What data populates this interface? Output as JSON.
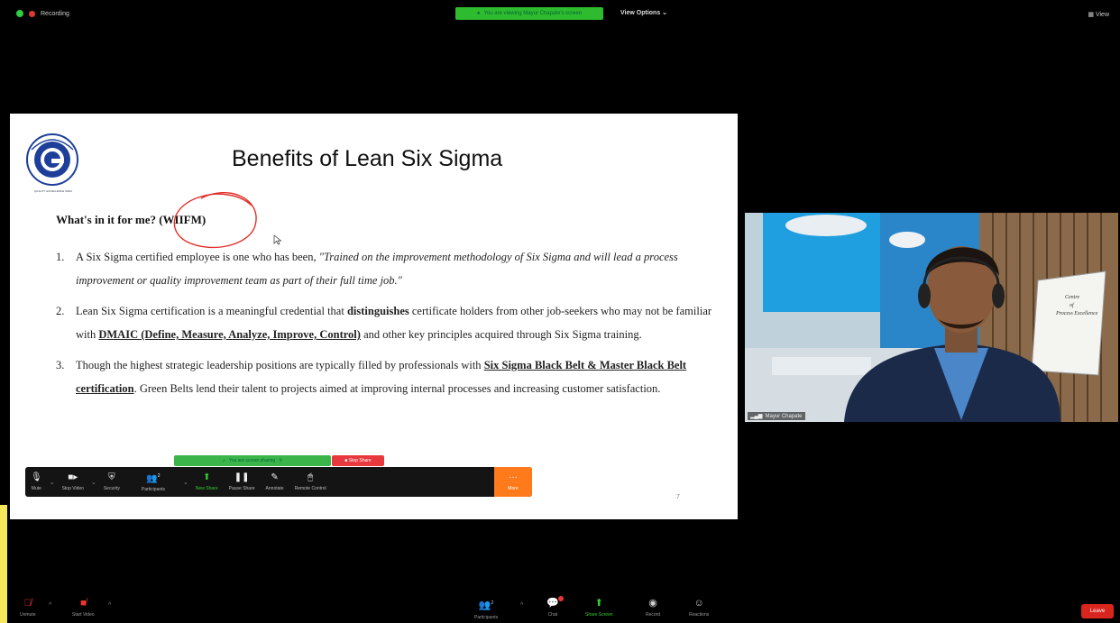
{
  "top_bar": {
    "recording_label": "Recording",
    "viewing_banner": "You are viewing Mayur Chapate's screen",
    "view_options": "View Options ⌄",
    "view_label": "View"
  },
  "slide": {
    "logo_caption": "QUALITY EXCELLENCE INDIA",
    "title": "Benefits of Lean Six Sigma",
    "subtitle": "What's in it for me? (WIIFM)",
    "points": [
      {
        "num": "1.",
        "a": "A Six Sigma certified employee is one who has been, ",
        "quote": "\"Trained on the improvement methodology of Six Sigma and will lead a process improvement or quality improvement team as part of their full time job.\""
      },
      {
        "num": "2.",
        "a": "Lean Six Sigma certification is a meaningful credential that ",
        "b": "distinguishes",
        "c": " certificate holders from other job-seekers who may not be familiar with ",
        "d": "DMAIC (Define, Measure, Analyze, Improve, Control)",
        "e": " and other key principles acquired through Six Sigma training."
      },
      {
        "num": "3.",
        "a": "Though the highest strategic leadership positions are typically filled by professionals with ",
        "b": "Six Sigma Black Belt & Master Black Belt  certification",
        "c": ". Green Belts lend their talent to projects aimed at improving internal processes and increasing customer satisfaction."
      }
    ],
    "page_number": "7"
  },
  "share_controls": {
    "sharing_banner": "You are screen sharing",
    "stop_share": "Stop Share",
    "toolbar": [
      {
        "icon": "mic-icon",
        "label": "Mute"
      },
      {
        "icon": "video-icon",
        "label": "Stop Video"
      },
      {
        "icon": "shield-icon",
        "label": "Security"
      },
      {
        "icon": "participants-icon",
        "label": "Participants"
      },
      {
        "icon": "share-icon",
        "label": "New Share"
      },
      {
        "icon": "pause-icon",
        "label": "Pause Share"
      },
      {
        "icon": "pen-icon",
        "label": "Annotate"
      },
      {
        "icon": "remote-icon",
        "label": "Remote Control"
      },
      {
        "icon": "more-icon",
        "label": "More"
      }
    ],
    "participants_count": "2"
  },
  "video": {
    "participant_name": "Mayur Chapate",
    "whiteboard_text": "Centre of Process Excellence"
  },
  "bottom_bar": {
    "items": [
      {
        "icon": "mic-muted-icon",
        "label": "Unmute"
      },
      {
        "icon": "video-off-icon",
        "label": "Start Video"
      },
      {
        "icon": "participants-icon",
        "label": "Participants"
      },
      {
        "icon": "chat-icon",
        "label": "Chat"
      },
      {
        "icon": "share-screen-icon",
        "label": "Share Screen"
      },
      {
        "icon": "record-icon",
        "label": "Record"
      },
      {
        "icon": "reactions-icon",
        "label": "Reactions"
      }
    ],
    "participants_count": "2",
    "leave": "Leave"
  },
  "colors": {
    "zoom_green": "#2fbb2f",
    "stop_red": "#e8383d",
    "more_orange": "#ff7a1a",
    "leave_red": "#d8261e",
    "annotation_red": "#e0302a"
  }
}
